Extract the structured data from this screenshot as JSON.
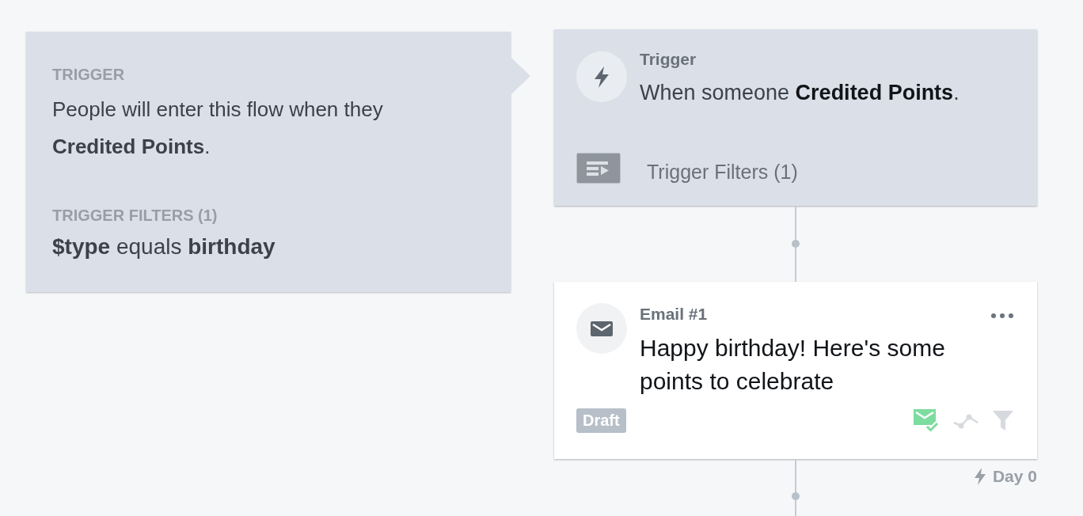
{
  "summary_panel": {
    "trigger_heading": "TRIGGER",
    "trigger_description": "People will enter this flow when they **Credited Points**.",
    "filters_heading": "TRIGGER FILTERS (1)",
    "filter_condition": "**$type** equals **birthday**"
  },
  "steps": [
    {
      "kind": "trigger",
      "label": "Trigger",
      "description": "When someone **Credited Points**.",
      "filters_label": "Trigger Filters (1)"
    },
    {
      "kind": "email",
      "label": "Email #1",
      "subject": "Happy birthday! Here's some points to celebrate",
      "status": "Draft",
      "indicators": [
        {
          "kind": "mail-check",
          "on": true
        },
        {
          "kind": "path",
          "on": false
        },
        {
          "kind": "filter",
          "on": false
        }
      ],
      "delay": "Day 0"
    }
  ]
}
